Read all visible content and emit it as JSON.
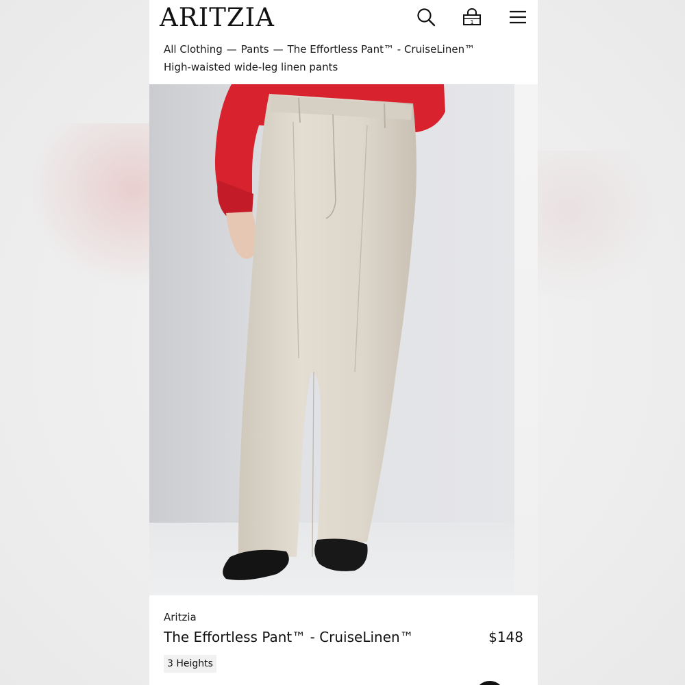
{
  "header": {
    "logo": "ARITZIA",
    "icons": [
      "search-icon",
      "shopping-bag-icon",
      "menu-icon"
    ],
    "bag_count": "1"
  },
  "breadcrumb": {
    "items": [
      "All Clothing",
      "Pants",
      "The Effortless Pant™ - CruiseLinen™"
    ],
    "separator": "—"
  },
  "page": {
    "subtitle": "High-waisted wide-leg linen pants"
  },
  "product": {
    "brand": "Aritzia",
    "name": "The Effortless Pant™ - CruiseLinen™",
    "price": "$148",
    "height_option": "3 Heights"
  },
  "colors": {
    "accent": "#111111",
    "sweater": "#d8232f",
    "pants": "#d9d3c8",
    "shoes": "#141414"
  }
}
